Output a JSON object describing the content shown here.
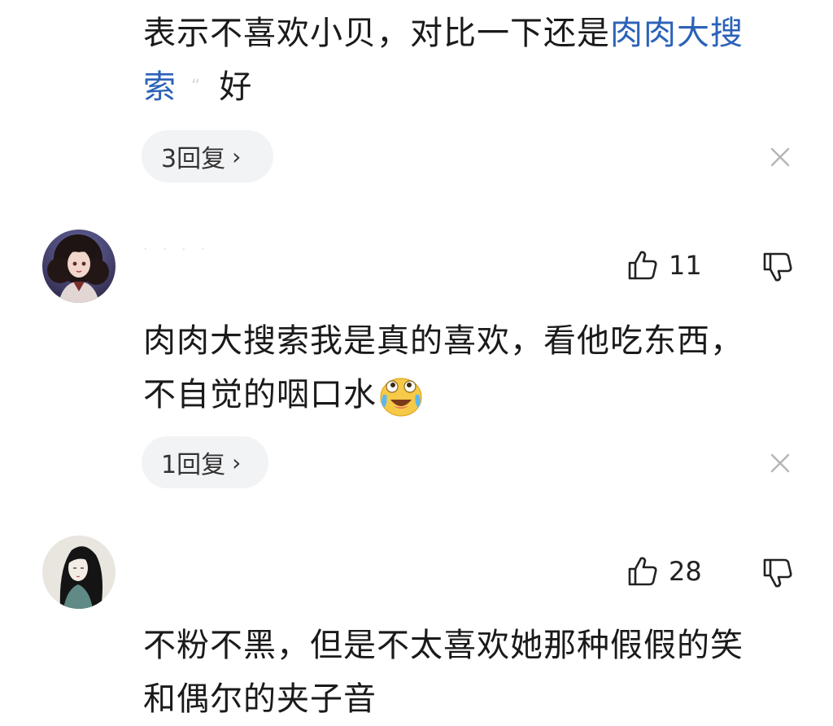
{
  "comment1": {
    "text_main": "表示不喜欢小贝，对比一下还是",
    "link_text": "肉肉大搜",
    "link_text_line2": "索",
    "faded_mark": "“",
    "text_end": "好",
    "reply_label": "3回复",
    "reply_chevron": "›"
  },
  "comment2": {
    "username": "· · · ·",
    "likes": "11",
    "text_line1": "肉肉大搜索我是真的喜欢，看他吃东西，",
    "text_line2": "不自觉的咽口水",
    "emoji_name": "tears-of-joy-emoji",
    "reply_label": "1回复",
    "reply_chevron": "›"
  },
  "comment3": {
    "likes": "28",
    "text_line1": "不粉不黑，但是不太喜欢她那种假假的笑",
    "text_line2": "和偶尔的夹子音"
  },
  "colors": {
    "link": "#2b62b8",
    "pill_bg": "#f2f3f5",
    "text": "#1a1a1a"
  }
}
